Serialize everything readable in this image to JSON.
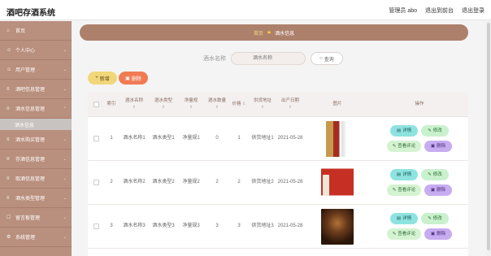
{
  "header": {
    "app_title": "酒吧存酒系统",
    "admin_label": "管理员 abo",
    "back_label": "退出到前台",
    "logout_label": "退出登录"
  },
  "sidebar": {
    "items": [
      {
        "icon": "home-icon",
        "label": "首页"
      },
      {
        "icon": "user-icon",
        "label": "个人中心"
      },
      {
        "icon": "users-icon",
        "label": "用户管理"
      },
      {
        "icon": "list-icon",
        "label": "酒吧信息管理"
      },
      {
        "icon": "list-icon",
        "label": "酒水信息管理"
      }
    ],
    "active_sub": "酒水信息",
    "items_after": [
      {
        "icon": "cart-icon",
        "label": "酒水购买管理"
      },
      {
        "icon": "list-icon",
        "label": "存酒信息管理"
      },
      {
        "icon": "list-icon",
        "label": "取酒信息管理"
      },
      {
        "icon": "list-icon",
        "label": "酒水类型管理"
      },
      {
        "icon": "chat-icon",
        "label": "留言板管理"
      },
      {
        "icon": "gear-icon",
        "label": "系统管理"
      }
    ]
  },
  "breadcrumb": {
    "home": "首页",
    "current": "酒水信息"
  },
  "search": {
    "label": "酒水名称",
    "placeholder": "酒水名称",
    "button_label": "查询"
  },
  "actions": {
    "add_label": "新增",
    "delete_label": "删除"
  },
  "table": {
    "columns": [
      "索引",
      "酒水名称",
      "酒水类型",
      "净量规",
      "酒水数量",
      "价格",
      "供货地址",
      "出产日期",
      "图片",
      "操作"
    ],
    "rows": [
      {
        "index": "1",
        "name": "酒水名称1",
        "type": "酒水类型1",
        "net": "净量规1",
        "qty": "0",
        "price": "1",
        "addr": "供货地址1",
        "date": "2021-05-28"
      },
      {
        "index": "2",
        "name": "酒水名称2",
        "type": "酒水类型2",
        "net": "净量规2",
        "qty": "2",
        "price": "2",
        "addr": "供货地址2",
        "date": "2021-05-28"
      },
      {
        "index": "3",
        "name": "酒水名称3",
        "type": "酒水类型3",
        "net": "净量规3",
        "qty": "3",
        "price": "3",
        "addr": "供货地址3",
        "date": "2021-05-28"
      }
    ],
    "op_labels": {
      "detail": "详情",
      "edit": "修改",
      "comment": "查看评论",
      "delete": "删除"
    }
  },
  "colors": {
    "sidebar_bg": "#b98f7d",
    "breadcrumb_bg": "#ad806c",
    "add_button": "#f2d77a",
    "delete_button": "#f07b53",
    "detail_button": "#8ee3e0",
    "edit_button": "#c9f1cd",
    "op_delete_button": "#c8acf0"
  }
}
